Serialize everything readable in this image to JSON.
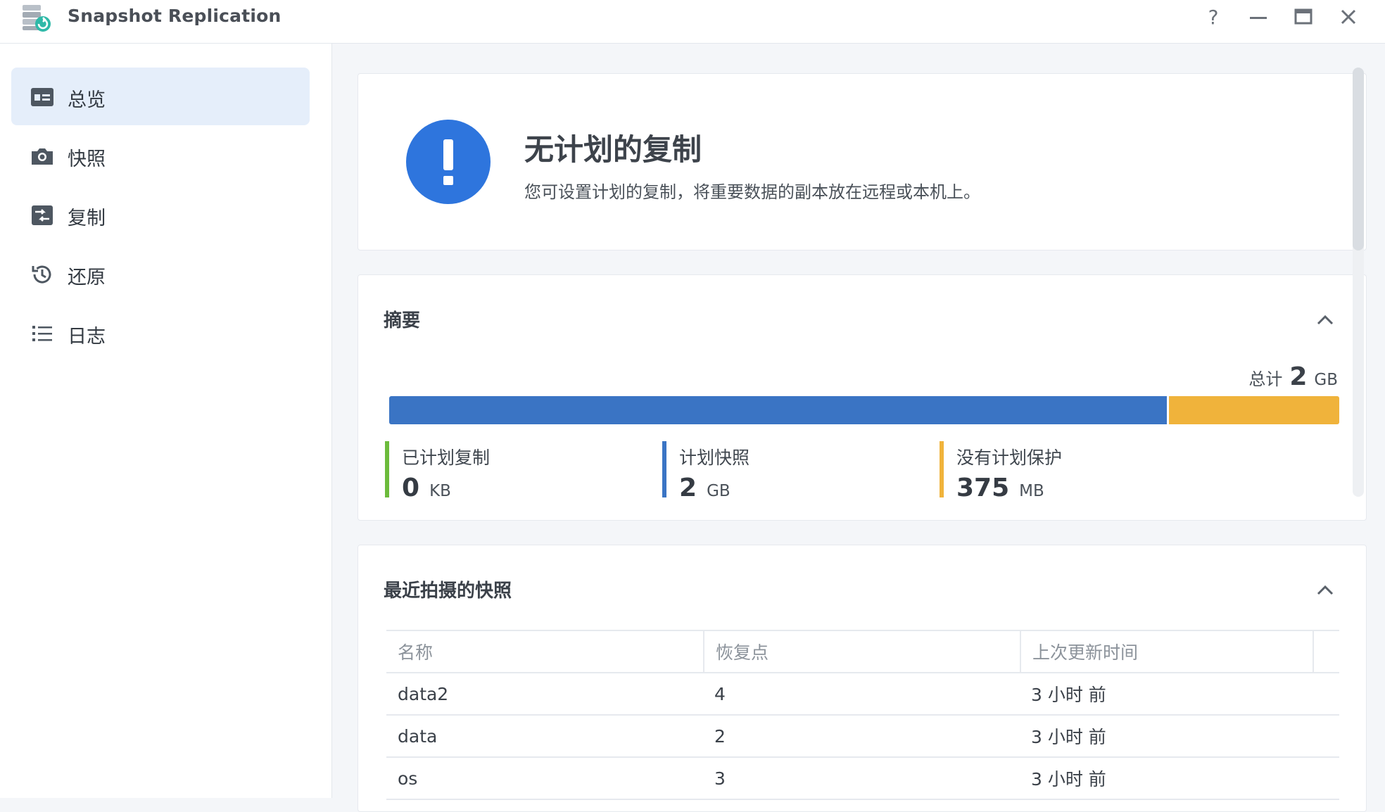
{
  "app": {
    "title": "Snapshot Replication",
    "window_controls": [
      "help-icon",
      "minimize-icon",
      "maximize-icon",
      "close-icon"
    ]
  },
  "sidebar": {
    "items": [
      {
        "label": "总览",
        "icon": "overview-icon",
        "active": true
      },
      {
        "label": "快照",
        "icon": "camera-icon",
        "active": false
      },
      {
        "label": "复制",
        "icon": "replication-icon",
        "active": false
      },
      {
        "label": "还原",
        "icon": "history-icon",
        "active": false
      },
      {
        "label": "日志",
        "icon": "list-icon",
        "active": false
      }
    ]
  },
  "status": {
    "icon": "exclamation-icon",
    "title": "无计划的复制",
    "description": "您可设置计划的复制，将重要数据的副本放在远程或本机上。",
    "color": "#2e75dd"
  },
  "summary": {
    "title": "摘要",
    "total_label": "总计",
    "total_value": "2",
    "total_unit": "GB",
    "bar": [
      {
        "name": "计划快照",
        "fraction": 0.82,
        "color": "#3a74c4"
      },
      {
        "name": "没有计划保护",
        "fraction": 0.18,
        "color": "#f0b33b"
      }
    ],
    "legend": [
      {
        "label": "已计划复制",
        "value": "0",
        "unit": "KB",
        "color": "#6cbb3c"
      },
      {
        "label": "计划快照",
        "value": "2",
        "unit": "GB",
        "color": "#3a74c4"
      },
      {
        "label": "没有计划保护",
        "value": "375",
        "unit": "MB",
        "color": "#f0b33b"
      }
    ]
  },
  "recent": {
    "title": "最近拍摄的快照",
    "columns": [
      "名称",
      "恢复点",
      "上次更新时间"
    ],
    "rows": [
      [
        "data2",
        "4",
        "3 小时 前"
      ],
      [
        "data",
        "2",
        "3 小时 前"
      ],
      [
        "os",
        "3",
        "3 小时 前"
      ]
    ]
  }
}
